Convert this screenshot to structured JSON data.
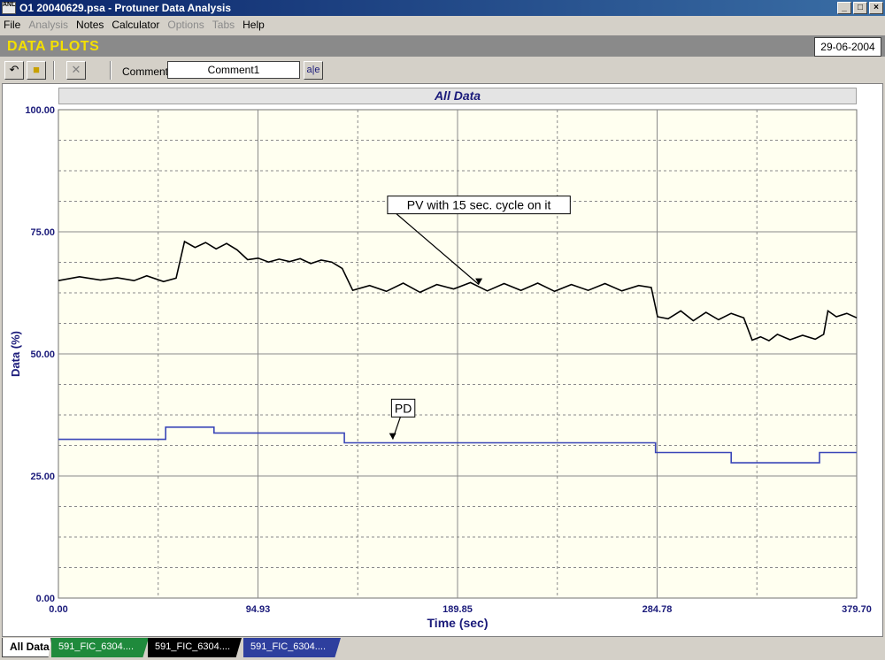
{
  "window": {
    "title": "O1 20040629.psa - Protuner Data  Analysis",
    "icon_text": "ANL"
  },
  "menu": [
    {
      "label": "File",
      "enabled": true
    },
    {
      "label": "Analysis",
      "enabled": false
    },
    {
      "label": "Notes",
      "enabled": true
    },
    {
      "label": "Calculator",
      "enabled": true
    },
    {
      "label": "Options",
      "enabled": false
    },
    {
      "label": "Tabs",
      "enabled": false
    },
    {
      "label": "Help",
      "enabled": true
    }
  ],
  "header": {
    "title": "DATA PLOTS",
    "date": "29-06-2004"
  },
  "toolbar": {
    "comment_label": "Comment",
    "comment_value": "Comment1",
    "edit_text": "a|e"
  },
  "tabs": [
    {
      "label": "All Data",
      "color": "#ffffff",
      "active": true
    },
    {
      "label": "591_FIC_6304....",
      "color": "#1f8a3c",
      "active": false
    },
    {
      "label": "591_FIC_6304....",
      "color": "#000000",
      "active": false
    },
    {
      "label": "591_FIC_6304....",
      "color": "#2e3f9e",
      "active": false
    }
  ],
  "chart_data": {
    "type": "line",
    "title": "All Data",
    "xlabel": "Time (sec)",
    "ylabel": "Data (%)",
    "xlim": [
      0,
      379.7
    ],
    "ylim": [
      0,
      100
    ],
    "x_ticks": [
      "0.00",
      "94.93",
      "189.85",
      "284.78",
      "379.70"
    ],
    "y_ticks": [
      "0.00",
      "25.00",
      "50.00",
      "75.00",
      "100.00"
    ],
    "grid": true,
    "background": "#fffff0",
    "series": [
      {
        "name": "PV with 15 sec. cycle on it",
        "color": "#000000",
        "x": [
          0,
          10,
          20,
          28,
          36,
          42,
          50,
          56,
          60,
          65,
          70,
          75,
          80,
          85,
          90,
          95,
          100,
          105,
          110,
          115,
          120,
          125,
          130,
          135,
          140,
          148,
          156,
          164,
          172,
          180,
          188,
          196,
          204,
          212,
          220,
          228,
          236,
          244,
          252,
          260,
          268,
          276,
          282,
          285,
          290,
          296,
          302,
          308,
          314,
          320,
          326,
          330,
          334,
          338,
          342,
          348,
          354,
          360,
          364,
          366,
          370,
          375,
          379.7
        ],
        "y": [
          65,
          65.8,
          65.1,
          65.6,
          65,
          66,
          64.8,
          65.5,
          73,
          71.8,
          72.8,
          71.5,
          72.6,
          71.3,
          69.3,
          69.6,
          68.8,
          69.4,
          68.9,
          69.5,
          68.5,
          69.2,
          68.8,
          67.5,
          63,
          64,
          62.8,
          64.5,
          62.6,
          64.2,
          63.3,
          64.6,
          62.9,
          64.4,
          63,
          64.5,
          62.8,
          64.2,
          63,
          64.4,
          62.9,
          64,
          63.6,
          57.6,
          57.2,
          58.8,
          56.8,
          58.5,
          57,
          58.3,
          57.4,
          52.8,
          53.5,
          52.7,
          54,
          52.9,
          53.8,
          53,
          54,
          58.8,
          57.6,
          58.3,
          57.4
        ]
      },
      {
        "name": "PD",
        "color": "#3a46b8",
        "x": [
          0,
          51,
          51,
          74,
          74,
          136,
          136,
          284,
          284,
          320,
          320,
          362,
          362,
          379.7
        ],
        "y": [
          32.5,
          32.5,
          35,
          35,
          33.8,
          33.8,
          31.8,
          31.8,
          29.8,
          29.8,
          27.7,
          27.7,
          29.8,
          29.8
        ]
      }
    ],
    "annotations": [
      {
        "text": "PV with 15 sec. cycle on it",
        "x": 200,
        "y": 80.5,
        "arrow_to": [
          200,
          64.2
        ]
      },
      {
        "text": "PD",
        "x": 164,
        "y": 38.9,
        "arrow_to": [
          159,
          32.5
        ]
      }
    ]
  }
}
